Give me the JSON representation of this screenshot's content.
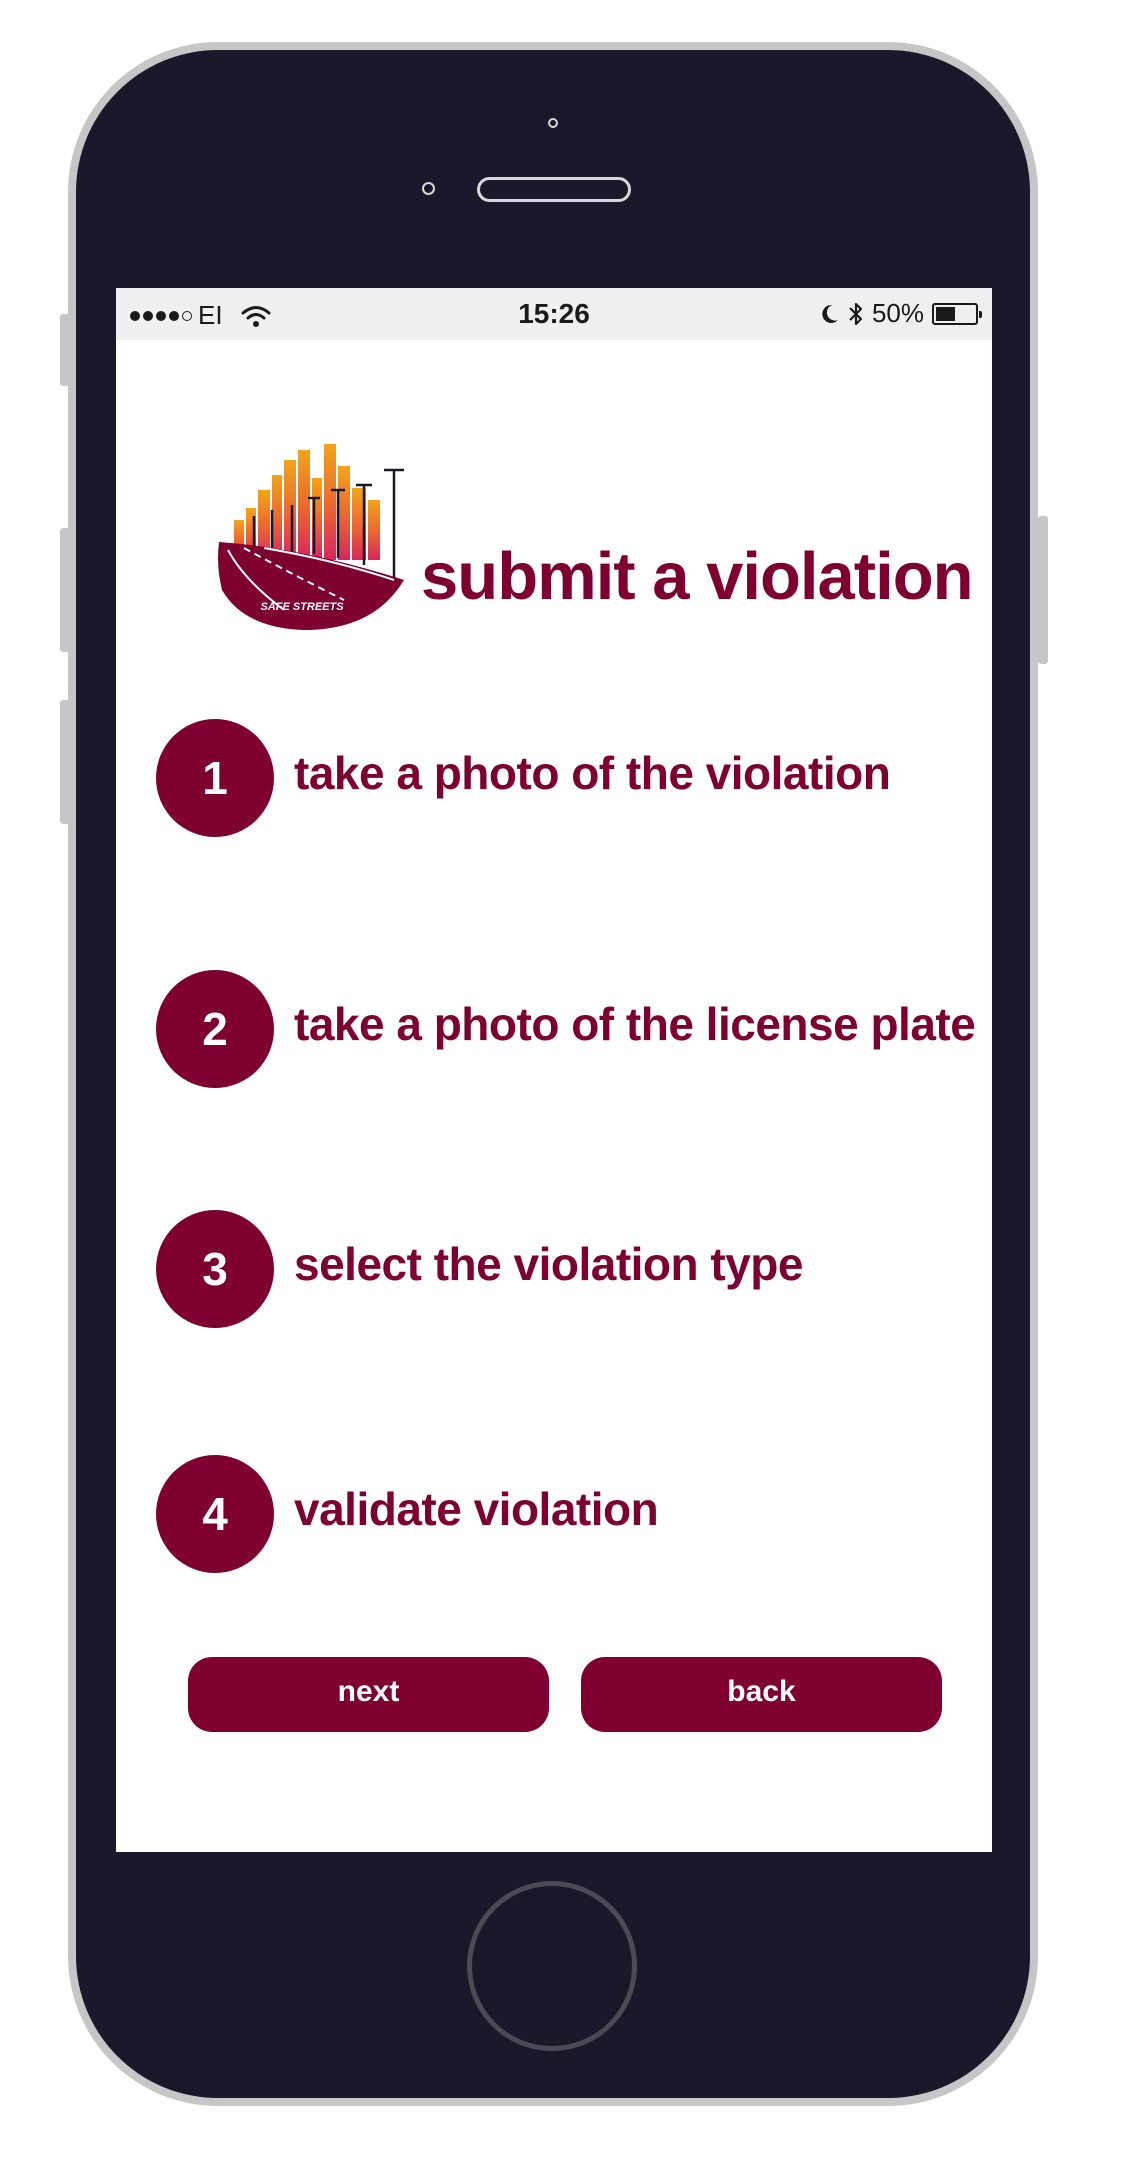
{
  "status_bar": {
    "carrier": "EI",
    "time": "15:26",
    "battery_text": "50%",
    "battery_level": 0.5
  },
  "header": {
    "logo_text": "SAFE STREETS",
    "title": "submit a violation"
  },
  "steps": [
    {
      "number": "1",
      "label": "take a photo of the violation"
    },
    {
      "number": "2",
      "label": "take a photo of the license plate"
    },
    {
      "number": "3",
      "label": "select the violation type"
    },
    {
      "number": "4",
      "label": "validate violation"
    }
  ],
  "buttons": {
    "next": "next",
    "back": "back"
  },
  "colors": {
    "brand": "#7e0030",
    "phone_frame": "#1c182c"
  }
}
